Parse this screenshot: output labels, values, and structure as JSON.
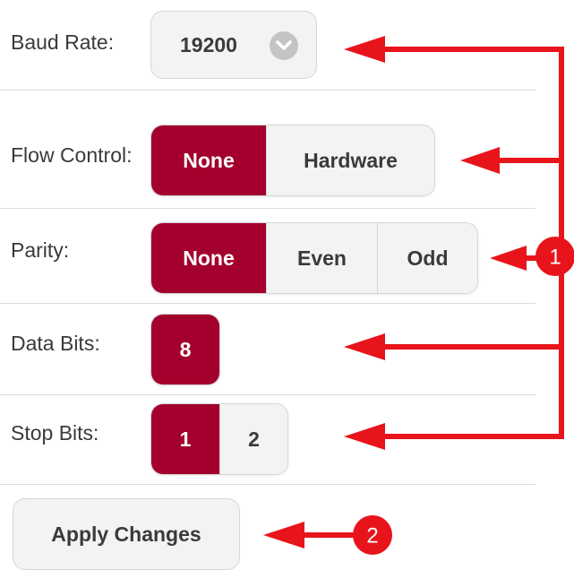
{
  "baud_rate": {
    "label": "Baud Rate:",
    "value": "19200",
    "icon": "chevron-down-icon"
  },
  "flow_control": {
    "label": "Flow Control:",
    "options": [
      "None",
      "Hardware"
    ],
    "selected": "None"
  },
  "parity": {
    "label": "Parity:",
    "options": [
      "None",
      "Even",
      "Odd"
    ],
    "selected": "None"
  },
  "data_bits": {
    "label": "Data Bits:",
    "options": [
      "8"
    ],
    "selected": "8"
  },
  "stop_bits": {
    "label": "Stop Bits:",
    "options": [
      "1",
      "2"
    ],
    "selected": "1"
  },
  "apply_button": {
    "label": "Apply Changes"
  },
  "callouts": [
    {
      "number": "1"
    },
    {
      "number": "2"
    }
  ],
  "colors": {
    "accent": "#a3002e",
    "annotation": "#e8141c",
    "segment_bg": "#f3f3f3"
  }
}
